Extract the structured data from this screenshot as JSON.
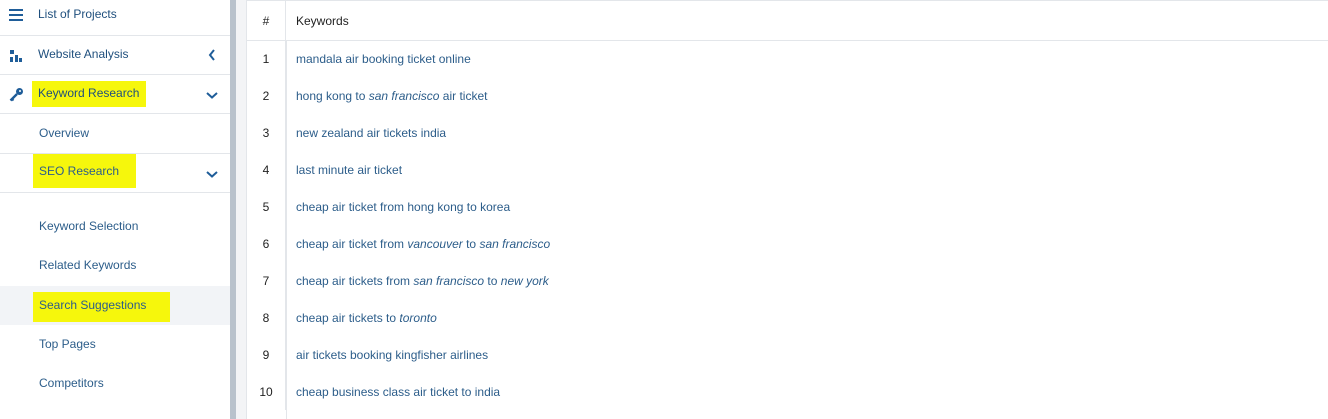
{
  "sidebar": {
    "main_items": [
      {
        "label": "List of Projects",
        "icon": "menu-icon"
      },
      {
        "label": "Website Analysis",
        "icon": "analysis-icon",
        "chevron": "chevron-left-icon"
      },
      {
        "label": "Keyword Research",
        "icon": "key-icon",
        "chevron": "chevron-down-icon",
        "highlighted": true
      }
    ],
    "overview_label": "Overview",
    "seo_research_label": "SEO Research",
    "sub_items": [
      {
        "label": "Keyword Selection"
      },
      {
        "label": "Related Keywords"
      },
      {
        "label": "Search Suggestions",
        "active": true,
        "highlighted": true
      },
      {
        "label": "Top Pages"
      },
      {
        "label": "Competitors"
      }
    ]
  },
  "table": {
    "headers": {
      "num": "#",
      "keywords": "Keywords"
    },
    "rows": [
      {
        "num": "1",
        "parts": [
          {
            "t": "mandala air booking ticket online",
            "i": false
          }
        ]
      },
      {
        "num": "2",
        "parts": [
          {
            "t": "hong kong to ",
            "i": false
          },
          {
            "t": "san francisco",
            "i": true
          },
          {
            "t": " air ticket",
            "i": false
          }
        ]
      },
      {
        "num": "3",
        "parts": [
          {
            "t": "new zealand air tickets india",
            "i": false
          }
        ]
      },
      {
        "num": "4",
        "parts": [
          {
            "t": "last minute air ticket",
            "i": false
          }
        ]
      },
      {
        "num": "5",
        "parts": [
          {
            "t": "cheap air ticket from hong kong to korea",
            "i": false
          }
        ]
      },
      {
        "num": "6",
        "parts": [
          {
            "t": "cheap air ticket from ",
            "i": false
          },
          {
            "t": "vancouver",
            "i": true
          },
          {
            "t": " to ",
            "i": false
          },
          {
            "t": "san francisco",
            "i": true
          }
        ]
      },
      {
        "num": "7",
        "parts": [
          {
            "t": "cheap air tickets from ",
            "i": false
          },
          {
            "t": "san francisco",
            "i": true
          },
          {
            "t": " to ",
            "i": false
          },
          {
            "t": "new york",
            "i": true
          }
        ]
      },
      {
        "num": "8",
        "parts": [
          {
            "t": "cheap air tickets to ",
            "i": false
          },
          {
            "t": "toronto",
            "i": true
          }
        ]
      },
      {
        "num": "9",
        "parts": [
          {
            "t": "air tickets booking kingfisher airlines",
            "i": false
          }
        ]
      },
      {
        "num": "10",
        "parts": [
          {
            "t": "cheap business class air ticket to india",
            "i": false
          }
        ]
      }
    ]
  },
  "colors": {
    "link": "#2c5d8a",
    "nav_text": "#1f4f7d",
    "highlight": "#f6f70c",
    "divider": "#b9c2cc"
  }
}
